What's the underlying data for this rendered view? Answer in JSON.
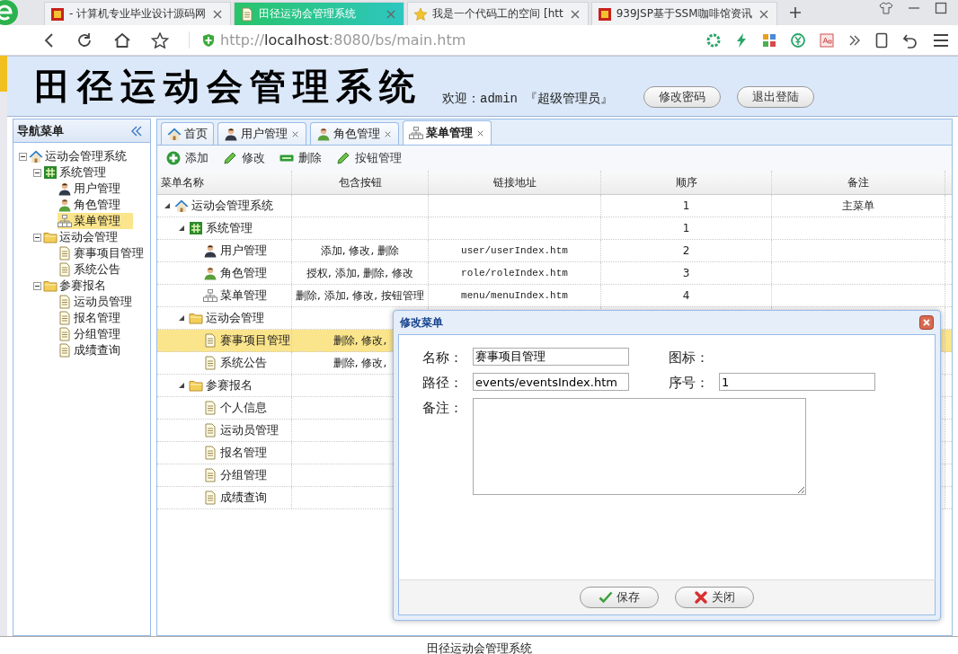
{
  "browser": {
    "tabs": [
      {
        "title": "- 计算机专业毕业设计源码网",
        "kind": "favicon",
        "selected": false
      },
      {
        "title": "田径运动会管理系统",
        "kind": "page",
        "selected": true
      },
      {
        "title": "我是一个代码工的空间 [htt",
        "kind": "star",
        "selected": false
      },
      {
        "title": "939JSP基于SSM咖啡馆资讯",
        "kind": "favicon",
        "selected": false
      }
    ],
    "url": {
      "scheme": "http://",
      "host": "localhost",
      "path": ":8080/bs/main.htm"
    }
  },
  "header": {
    "title": "田径运动会管理系统",
    "welcome": "欢迎：admin 『超级管理员』",
    "buttons": [
      "修改密码",
      "退出登陆"
    ]
  },
  "sidebar": {
    "title": "导航菜单",
    "tree": [
      {
        "label": "运动会管理系统",
        "kind": "home",
        "expanded": true,
        "selected": false,
        "children": [
          {
            "label": "系统管理",
            "kind": "hash",
            "expanded": true,
            "selected": false,
            "children": [
              {
                "label": "用户管理",
                "kind": "user",
                "selected": false
              },
              {
                "label": "角色管理",
                "kind": "user-green",
                "selected": false
              },
              {
                "label": "菜单管理",
                "kind": "sitemap",
                "selected": true
              }
            ]
          },
          {
            "label": "运动会管理",
            "kind": "folder",
            "expanded": true,
            "selected": false,
            "children": [
              {
                "label": "赛事项目管理",
                "kind": "page",
                "selected": false
              },
              {
                "label": "系统公告",
                "kind": "page",
                "selected": false
              }
            ]
          },
          {
            "label": "参赛报名",
            "kind": "folder",
            "expanded": true,
            "selected": false,
            "children": [
              {
                "label": "运动员管理",
                "kind": "page",
                "selected": false
              },
              {
                "label": "报名管理",
                "kind": "page",
                "selected": false
              },
              {
                "label": "分组管理",
                "kind": "page",
                "selected": false
              },
              {
                "label": "成绩查询",
                "kind": "page",
                "selected": false
              }
            ]
          }
        ]
      }
    ]
  },
  "content_tabs": [
    {
      "label": "首页",
      "kind": "home",
      "closable": false,
      "selected": false
    },
    {
      "label": "用户管理",
      "kind": "user",
      "closable": true,
      "selected": false
    },
    {
      "label": "角色管理",
      "kind": "user-green",
      "closable": true,
      "selected": false
    },
    {
      "label": "菜单管理",
      "kind": "sitemap",
      "closable": true,
      "selected": true
    }
  ],
  "toolbar": [
    {
      "label": "添加",
      "kind": "plus"
    },
    {
      "label": "修改",
      "kind": "pencil"
    },
    {
      "label": "删除",
      "kind": "minus"
    },
    {
      "label": "按钮管理",
      "kind": "pencil"
    }
  ],
  "menu_table": {
    "columns": [
      "菜单名称",
      "包含按钮",
      "链接地址",
      "顺序",
      "备注"
    ],
    "rows": [
      {
        "name": "运动会管理系统",
        "kind": "home",
        "expanded": true,
        "selected": false,
        "order": "1",
        "note": "主菜单",
        "children": [
          {
            "name": "系统管理",
            "kind": "hash",
            "expanded": true,
            "selected": false,
            "order": "1",
            "children": [
              {
                "name": "用户管理",
                "kind": "user",
                "selected": false,
                "buttons": "添加, 修改, 删除",
                "link": "user/userIndex.htm",
                "order": "2"
              },
              {
                "name": "角色管理",
                "kind": "user-green",
                "selected": false,
                "buttons": "授权, 添加, 删除, 修改",
                "link": "role/roleIndex.htm",
                "order": "3"
              },
              {
                "name": "菜单管理",
                "kind": "sitemap",
                "selected": false,
                "buttons": "删除, 添加, 修改, 按钮管理",
                "link": "menu/menuIndex.htm",
                "order": "4"
              }
            ]
          },
          {
            "name": "运动会管理",
            "kind": "folder",
            "expanded": true,
            "selected": false,
            "children": [
              {
                "name": "赛事项目管理",
                "kind": "page",
                "selected": true,
                "buttons": "删除, 修改,"
              },
              {
                "name": "系统公告",
                "kind": "page",
                "selected": false,
                "buttons": "删除, 修改,"
              }
            ]
          },
          {
            "name": "参赛报名",
            "kind": "folder",
            "expanded": true,
            "selected": false,
            "children": [
              {
                "name": "个人信息",
                "kind": "page",
                "selected": false
              },
              {
                "name": "运动员管理",
                "kind": "page",
                "selected": false
              },
              {
                "name": "报名管理",
                "kind": "page",
                "selected": false
              },
              {
                "name": "分组管理",
                "kind": "page",
                "selected": false
              },
              {
                "name": "成绩查询",
                "kind": "page",
                "selected": false
              }
            ]
          }
        ]
      }
    ]
  },
  "dialog": {
    "title": "修改菜单",
    "fields": [
      {
        "label": "名称：",
        "kind": "text",
        "value": "赛事项目管理"
      },
      {
        "label": "图标：",
        "kind": "none"
      },
      {
        "label": "路径：",
        "kind": "text",
        "value": "events/eventsIndex.htm"
      },
      {
        "label": "序号：",
        "kind": "text",
        "value": "1"
      },
      {
        "label": "备注：",
        "kind": "textarea"
      }
    ],
    "buttons": [
      {
        "label": "保存",
        "kind": "check"
      },
      {
        "label": "关闭",
        "kind": "cross"
      }
    ]
  },
  "footer": "田径运动会管理系统"
}
